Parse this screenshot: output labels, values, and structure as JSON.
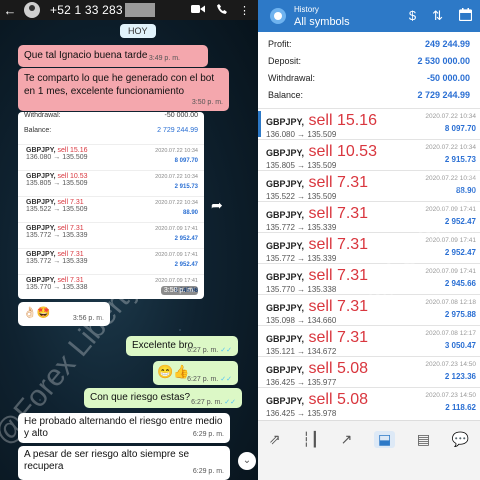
{
  "whatsapp": {
    "back_icon": "arrow-left-icon",
    "phone": "+52 1 33 283",
    "day_label": "HOY",
    "messages": {
      "m1_text": "Que tal Ignacio buena tarde",
      "m1_time": "3:49 p. m.",
      "m2_text": "Te comparto lo que he generado con el bot en 1 mes, excelente funcionamiento",
      "m2_time": "3:50 p. m.",
      "emoji_text": "👌🏻🤩",
      "emoji_time": "3:56 p. m.",
      "o1_text": "Excelente bro",
      "o1_time": "6:27 p. m.",
      "o2_text": "😁👍",
      "o2_time": "6:27 p. m.",
      "o3_text": "Con que riesgo estas?",
      "o3_time": "6:27 p. m.",
      "i1_text": "He probado alternando el riesgo entre medio y alto",
      "i1_time": "6:29 p. m.",
      "i2_text": "A pesar de ser riesgo alto siempre se recupera",
      "i2_time": "6:29 p. m."
    },
    "screenshot": {
      "withdrawal_label": "Withdrawal:",
      "withdrawal_value": "-50 000.00",
      "balance_label": "Balance:",
      "balance_value": "2 729 244.99",
      "stamp": "3:50 p. m.",
      "rows": [
        {
          "sym": "GBPJPY,",
          "side": "sell 15.16",
          "px": "136.080 → 135.509",
          "dt": "2020.07.22 10:34",
          "pl": "8 097.70"
        },
        {
          "sym": "GBPJPY,",
          "side": "sell 10.53",
          "px": "135.805 → 135.509",
          "dt": "2020.07.22 10:34",
          "pl": "2 915.73"
        },
        {
          "sym": "GBPJPY,",
          "side": "sell 7.31",
          "px": "135.522 → 135.509",
          "dt": "2020.07.22 10:34",
          "pl": "88.90"
        },
        {
          "sym": "GBPJPY,",
          "side": "sell 7.31",
          "px": "135.772 → 135.339",
          "dt": "2020.07.09 17:41",
          "pl": "2 952.47"
        },
        {
          "sym": "GBPJPY,",
          "side": "sell 7.31",
          "px": "135.772 → 135.339",
          "dt": "2020.07.09 17:41",
          "pl": "2 952.47"
        },
        {
          "sym": "GBPJPY,",
          "side": "sell 7.31",
          "px": "135.770 → 135.338",
          "dt": "2020.07.09 17:41",
          "pl": "2 945.66"
        },
        {
          "sym": "GBPJPY,",
          "side": "sell 7.31",
          "px": "",
          "dt": "",
          "pl": ""
        }
      ]
    },
    "watermark": "@Forex Liberty"
  },
  "mt4": {
    "title_small": "History",
    "title_main": "All symbols",
    "summary": {
      "profit_label": "Profit:",
      "profit_value": "249 244.99",
      "deposit_label": "Deposit:",
      "deposit_value": "2 530 000.00",
      "withdrawal_label": "Withdrawal:",
      "withdrawal_value": "-50 000.00",
      "balance_label": "Balance:",
      "balance_value": "2 729 244.99"
    },
    "rows": [
      {
        "sym": "GBPJPY,",
        "side": "sell 15.16",
        "px": "136.080 → 135.509",
        "dt": "2020.07.22 10:34",
        "pl": "8 097.70"
      },
      {
        "sym": "GBPJPY,",
        "side": "sell 10.53",
        "px": "135.805 → 135.509",
        "dt": "2020.07.22 10:34",
        "pl": "2 915.73"
      },
      {
        "sym": "GBPJPY,",
        "side": "sell 7.31",
        "px": "135.522 → 135.509",
        "dt": "2020.07.22 10:34",
        "pl": "88.90"
      },
      {
        "sym": "GBPJPY,",
        "side": "sell 7.31",
        "px": "135.772 → 135.339",
        "dt": "2020.07.09 17:41",
        "pl": "2 952.47"
      },
      {
        "sym": "GBPJPY,",
        "side": "sell 7.31",
        "px": "135.772 → 135.339",
        "dt": "2020.07.09 17:41",
        "pl": "2 952.47"
      },
      {
        "sym": "GBPJPY,",
        "side": "sell 7.31",
        "px": "135.770 → 135.338",
        "dt": "2020.07.09 17:41",
        "pl": "2 945.66"
      },
      {
        "sym": "GBPJPY,",
        "side": "sell 7.31",
        "px": "135.098 → 134.660",
        "dt": "2020.07.08 12:18",
        "pl": "2 975.88"
      },
      {
        "sym": "GBPJPY,",
        "side": "sell 7.31",
        "px": "135.121 → 134.672",
        "dt": "2020.07.08 12:17",
        "pl": "3 050.47"
      },
      {
        "sym": "GBPJPY,",
        "side": "sell 5.08",
        "px": "136.425 → 135.977",
        "dt": "2020.07.23 14:50",
        "pl": "2 123.36"
      },
      {
        "sym": "GBPJPY,",
        "side": "sell 5.08",
        "px": "136.425 → 135.978",
        "dt": "2020.07.23 14:50",
        "pl": "2 118.62"
      }
    ],
    "watermark": "@Forex Liberty"
  },
  "colors": {
    "mt_blue": "#2d79c7",
    "sell_red": "#d9363e",
    "profit_blue": "#2a6fd3",
    "wa_out": "#dcf8c6",
    "wa_pink": "#f4a7ad"
  }
}
